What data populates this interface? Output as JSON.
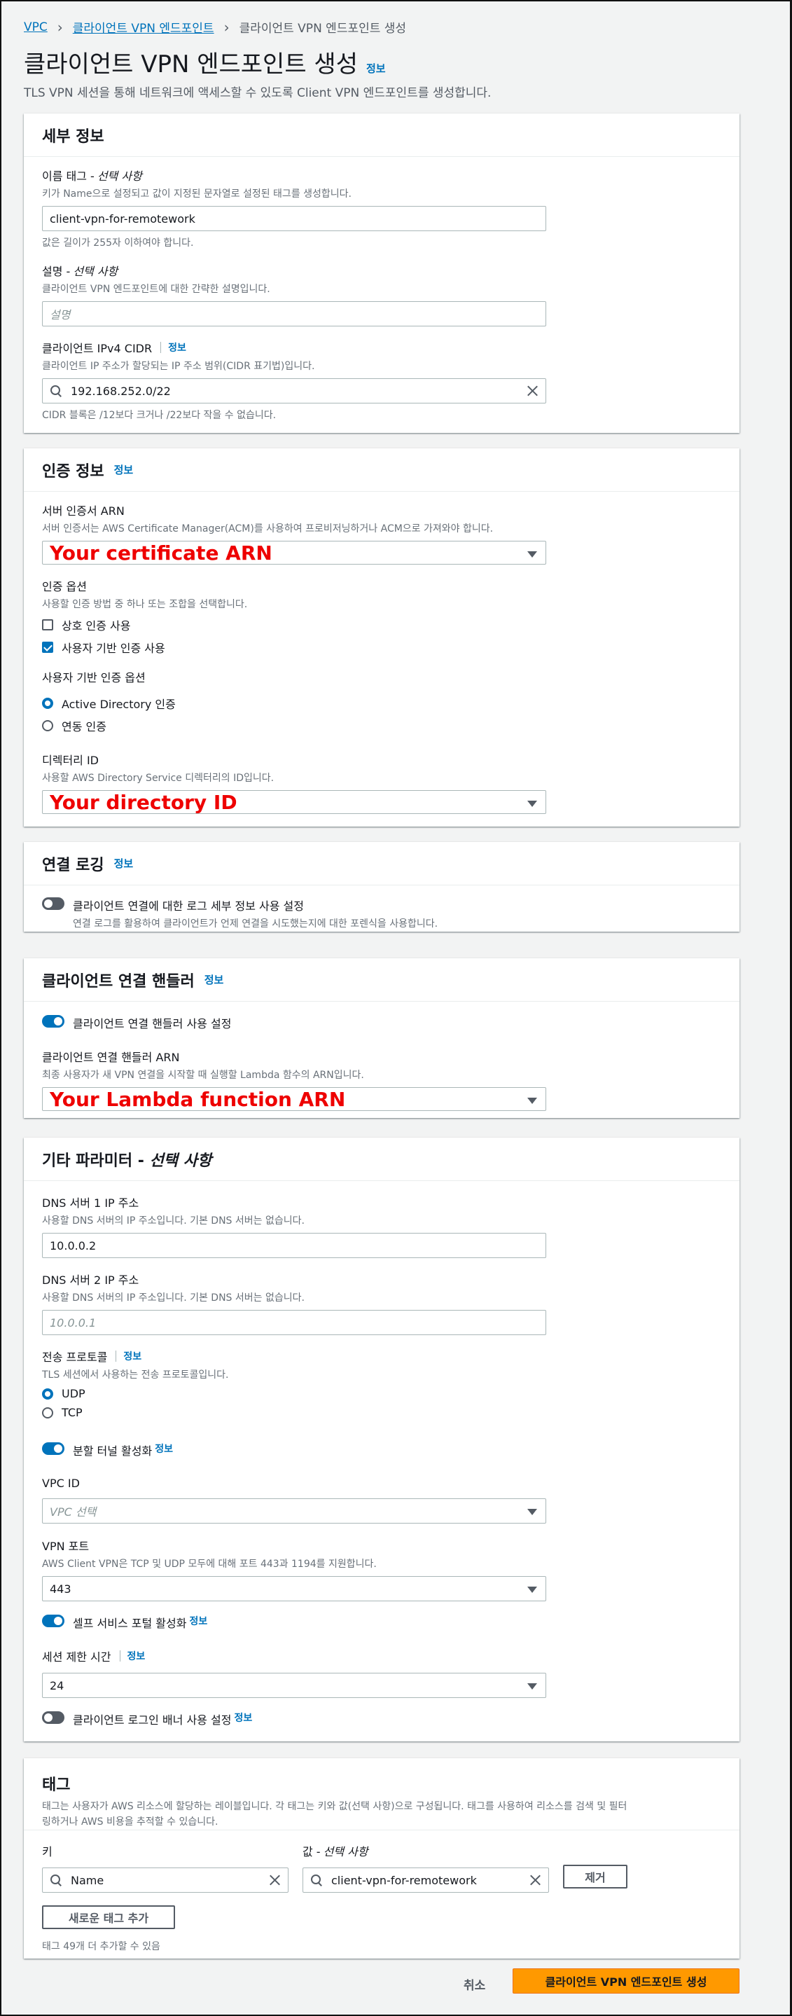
{
  "breadcrumb": {
    "vpc": "VPC",
    "endpoints": "클라이언트 VPN 엔드포인트",
    "current": "클라이언트 VPN 엔드포인트 생성"
  },
  "header": {
    "title": "클라이언트 VPN 엔드포인트 생성",
    "info": "정보",
    "description": "TLS VPN 세션을 통해 네트워크에 액세스할 수 있도록 Client VPN 엔드포인트를 생성합니다."
  },
  "details": {
    "title": "세부 정보",
    "name_tag": {
      "label": "이름 태그 -",
      "optional": "선택 사항",
      "desc": "키가 Name으로 설정되고 값이 지정된 문자열로 설정된 태그를 생성합니다.",
      "value": "client-vpn-for-remotework",
      "hint": "값은 길이가 255자 이하여야 합니다."
    },
    "description": {
      "label": "설명 -",
      "optional": "선택 사항",
      "desc": "클라이언트 VPN 엔드포인트에 대한 간략한 설명입니다.",
      "placeholder": "설명"
    },
    "cidr": {
      "label": "클라이언트 IPv4 CIDR",
      "info": "정보",
      "desc": "클라이언트 IP 주소가 할당되는 IP 주소 범위(CIDR 표기법)입니다.",
      "value": "192.168.252.0/22",
      "hint": "CIDR 블록은 /12보다 크거나 /22보다 작을 수 없습니다."
    }
  },
  "auth": {
    "title": "인증 정보",
    "info": "정보",
    "server_cert": {
      "label": "서버 인증서 ARN",
      "desc": "서버 인증서는 AWS Certificate Manager(ACM)를 사용하여 프로비저닝하거나 ACM으로 가져와야 합니다.",
      "value": "Your certificate ARN"
    },
    "options": {
      "label": "인증 옵션",
      "desc": "사용할 인증 방법 중 하나 또는 조합을 선택합니다.",
      "mutual": "상호 인증 사용",
      "user_based": "사용자 기반 인증 사용"
    },
    "user_options": {
      "label": "사용자 기반 인증 옵션",
      "ad": "Active Directory 인증",
      "federated": "연동 인증"
    },
    "directory": {
      "label": "디렉터리 ID",
      "desc": "사용할 AWS Directory Service 디렉터리의 ID입니다.",
      "value": "Your directory ID"
    }
  },
  "logging": {
    "title": "연결 로깅",
    "info": "정보",
    "toggle_label": "클라이언트 연결에 대한 로그 세부 정보 사용 설정",
    "toggle_desc": "연결 로그를 활용하여 클라이언트가 언제 연결을 시도했는지에 대한 포렌식을 사용합니다."
  },
  "handler": {
    "title": "클라이언트 연결 핸들러",
    "info": "정보",
    "toggle_label": "클라이언트 연결 핸들러 사용 설정",
    "arn_label": "클라이언트 연결 핸들러 ARN",
    "arn_desc": "최종 사용자가 새 VPN 연결을 시작할 때 실행할 Lambda 함수의 ARN입니다.",
    "arn_value": "Your Lambda function ARN"
  },
  "other": {
    "title": "기타 파라미터 -",
    "title_optional": "선택 사항",
    "dns1": {
      "label": "DNS 서버 1 IP 주소",
      "desc": "사용할 DNS 서버의 IP 주소입니다. 기본 DNS 서버는 없습니다.",
      "value": "10.0.0.2"
    },
    "dns2": {
      "label": "DNS 서버 2 IP 주소",
      "desc": "사용할 DNS 서버의 IP 주소입니다. 기본 DNS 서버는 없습니다.",
      "placeholder": "10.0.0.1"
    },
    "transport": {
      "label": "전송 프로토콜",
      "info": "정보",
      "desc": "TLS 세션에서 사용하는 전송 프로토콜입니다.",
      "udp": "UDP",
      "tcp": "TCP"
    },
    "split_tunnel": {
      "label": "분할 터널 활성화",
      "info": "정보"
    },
    "vpc_id": {
      "label": "VPC ID",
      "placeholder": "VPC 선택"
    },
    "vpn_port": {
      "label": "VPN 포트",
      "desc": "AWS Client VPN은 TCP 및 UDP 모두에 대해 포트 443과 1194를 지원합니다.",
      "value": "443"
    },
    "self_service": {
      "label": "셀프 서비스 포털 활성화",
      "info": "정보"
    },
    "session_timeout": {
      "label": "세션 제한 시간",
      "info": "정보",
      "value": "24"
    },
    "banner": {
      "label": "클라이언트 로그인 배너 사용 설정",
      "info": "정보"
    }
  },
  "tags": {
    "title": "태그",
    "desc1": "태그는 사용자가 AWS 리소스에 할당하는 레이블입니다. 각 태그는 키와 값(선택 사항)으로 구성됩니다. 태그를 사용하여 리소스를 검색 및 필터",
    "desc2": "링하거나 AWS 비용을 추적할 수 있습니다.",
    "key_label": "키",
    "value_label": "값 -",
    "value_optional": "선택 사항",
    "key_value": "Name",
    "value_value": "client-vpn-for-remotework",
    "remove": "제거",
    "add": "새로운 태그 추가",
    "remaining": "태그 49개 더 추가할 수 있음"
  },
  "footer": {
    "cancel": "취소",
    "create": "클라이언트 VPN 엔드포인트 생성"
  }
}
